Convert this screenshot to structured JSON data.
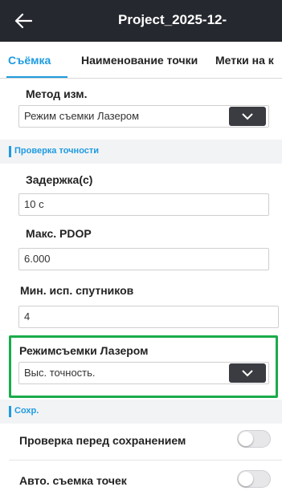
{
  "header": {
    "title": "Project_2025-12-",
    "back_icon": "arrow-left-icon"
  },
  "tabs": [
    {
      "label": "Съёмка",
      "active": true
    },
    {
      "label": "Наименование точки",
      "active": false
    },
    {
      "label": "Метки на к",
      "active": false
    }
  ],
  "method": {
    "label": "Метод изм.",
    "value": "Режим съемки Лазером"
  },
  "accuracy_section": {
    "title": "Проверка точности"
  },
  "delay": {
    "label": "Задержка(с)",
    "value": "10 с"
  },
  "pdop": {
    "label": "Макс. PDOP",
    "value": "6.000"
  },
  "satellites": {
    "label": "Мин. исп. спутников",
    "value": "4"
  },
  "laser_mode": {
    "label": "Режимсъемки Лазером",
    "value": "Выс. точность."
  },
  "save_section": {
    "title": "Сохр."
  },
  "check_before_save": {
    "label": "Проверка перед сохранением",
    "enabled": false
  },
  "auto_survey": {
    "label": "Авто. съемка точек",
    "enabled": false
  },
  "colors": {
    "accent": "#1e9be0",
    "header_bg": "#26282f",
    "highlight": "#1aab4b",
    "button_bg": "#3a3c42"
  }
}
